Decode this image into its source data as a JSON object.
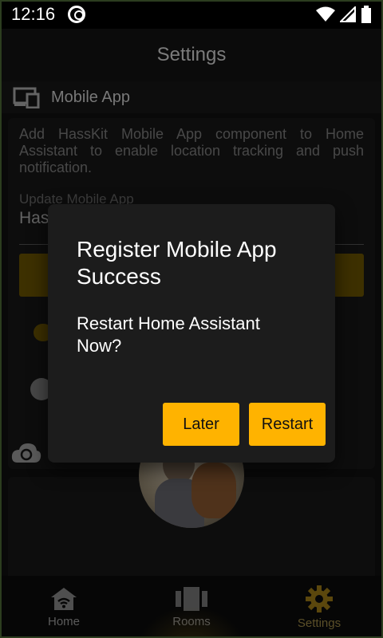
{
  "status_bar": {
    "time": "12:16"
  },
  "app_bar": {
    "title": "Settings"
  },
  "section": {
    "title": "Mobile App"
  },
  "mobile_app": {
    "description": "Add HassKit Mobile App component to Home Assistant to enable location tracking and push notification.",
    "field_label": "Update Mobile App",
    "field_value": "Has"
  },
  "dialog": {
    "title": "Register Mobile App Success",
    "body": "Restart Home Assistant Now?",
    "later_label": "Later",
    "restart_label": "Restart"
  },
  "bottom_nav": [
    {
      "label": "Home",
      "icon": "home-wifi-icon"
    },
    {
      "label": "Rooms",
      "icon": "rooms-icon"
    },
    {
      "label": "Settings",
      "icon": "gear-icon"
    }
  ],
  "colors": {
    "accent": "#ffb300",
    "dialog_bg": "#1c1c1c"
  }
}
